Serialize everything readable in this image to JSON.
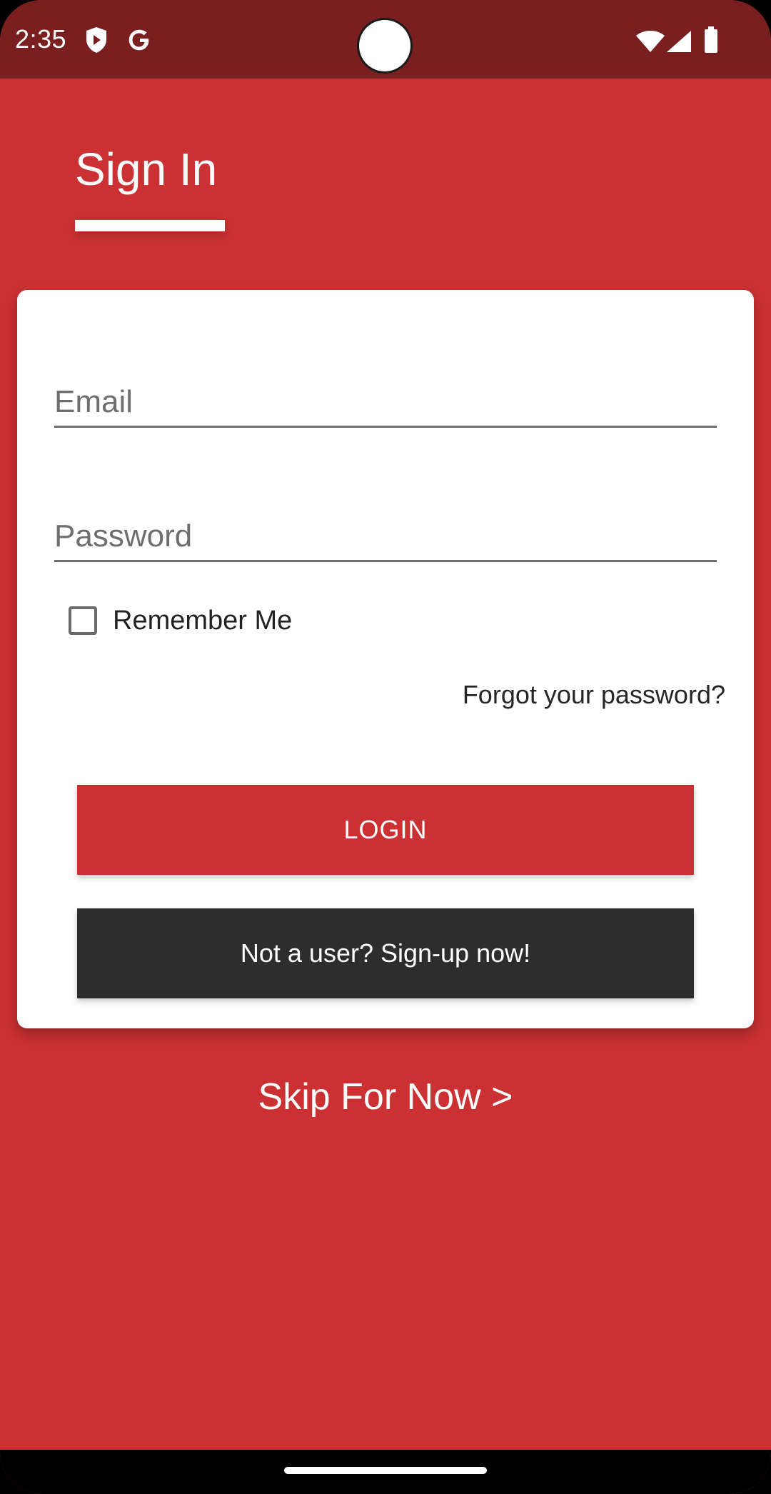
{
  "status_bar": {
    "time": "2:35",
    "icons": [
      "shield-icon",
      "google-icon",
      "wifi-icon",
      "signal-icon",
      "battery-icon"
    ]
  },
  "tabs": {
    "active_label": "Sign In"
  },
  "form": {
    "email_placeholder": "Email",
    "email_value": "",
    "password_placeholder": "Password",
    "password_value": "",
    "remember_label": "Remember Me",
    "remember_checked": false,
    "forgot_label": "Forgot your password?",
    "login_label": "LOGIN",
    "signup_label": "Not a user? Sign-up now!"
  },
  "skip_label": "Skip For Now >",
  "colors": {
    "brand_red": "#cb3132",
    "status_bar": "#7a1f1f",
    "signup_button": "#2d2d2d",
    "card": "#ffffff"
  }
}
